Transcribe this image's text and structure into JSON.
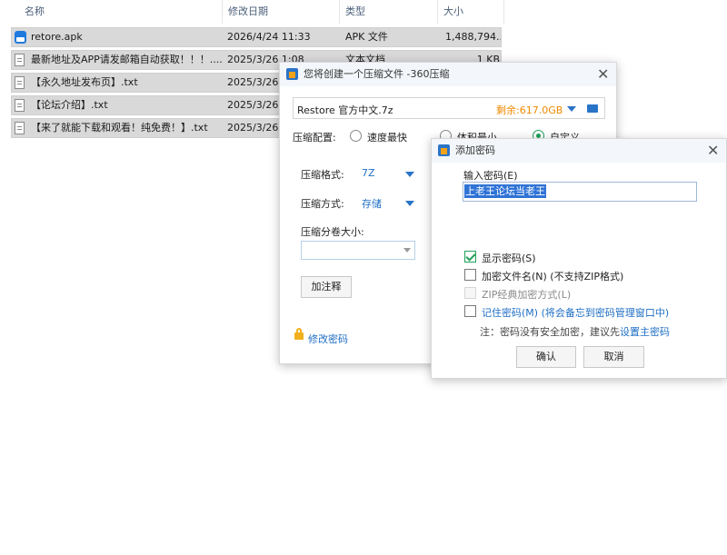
{
  "explorer": {
    "columns": [
      "名称",
      "修改日期",
      "类型",
      "大小"
    ],
    "files": [
      {
        "name": "retore.apk",
        "date": "2026/4/24 11:33",
        "type": "APK 文件",
        "size": "1,488,794...",
        "icon": "apk-icon"
      },
      {
        "name": "最新地址及APP请发邮箱自动获取！！！....",
        "date": "2025/3/26 1:08",
        "type": "文本文档",
        "size": "1 KB",
        "icon": "text-file-icon"
      },
      {
        "name": "【永久地址发布页】.txt",
        "date": "2025/3/26",
        "icon": "text-file-icon"
      },
      {
        "name": "【论坛介绍】.txt",
        "date": "2025/3/26",
        "icon": "text-file-icon"
      },
      {
        "name": "【来了就能下载和观看！纯免费！】.txt",
        "date": "2025/3/26",
        "icon": "text-file-icon"
      }
    ]
  },
  "compress_dialog": {
    "title": "您将创建一个压缩文件 -360压缩",
    "filename": "Restore 官方中文.7z",
    "remaining": "剩余:617.0GB",
    "config_label": "压缩配置:",
    "options": [
      "速度最快",
      "体积最小",
      "自定义"
    ],
    "selected_option": "自定义",
    "format_label": "压缩格式:",
    "format_value": "7Z",
    "method_label": "压缩方式:",
    "method_value": "存储",
    "split_label": "压缩分卷大小:",
    "split_value": "",
    "comment_button": "加注释",
    "change_password_link": "修改密码",
    "accent_color": "#f08a00"
  },
  "password_dialog": {
    "title": "添加密码",
    "input_label": "输入密码(E)",
    "password_value": "上老王论坛当老王",
    "show_password": "显示密码(S)",
    "encrypt_filenames": "加密文件名(N) (不支持ZIP格式)",
    "zip_classic": "ZIP经典加密方式(L)",
    "remember_password": "记住密码(M) (将会备忘到密码管理窗口中)",
    "note_prefix": "注：密码没有安全加密，建议先",
    "note_link": "设置主密码",
    "confirm_button": "确认",
    "cancel_button": "取消",
    "show_password_checked": true,
    "encrypt_filenames_checked": false,
    "zip_classic_checked": false,
    "remember_password_checked": false
  }
}
